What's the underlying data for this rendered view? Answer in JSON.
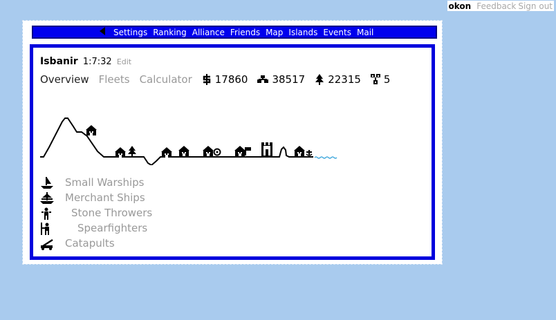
{
  "userbar": {
    "username": "okon",
    "links": [
      "Feedback",
      "Sign out"
    ]
  },
  "nav": {
    "back_icon": "back-arrow-icon",
    "items": [
      "Settings",
      "Ranking",
      "Alliance",
      "Friends",
      "Map",
      "Islands",
      "Events",
      "Mail"
    ]
  },
  "town": {
    "name": "Isbanir",
    "time": "1:7:32",
    "edit_label": "Edit"
  },
  "tabs": [
    {
      "label": "Overview",
      "active": true
    },
    {
      "label": "Fleets",
      "active": false
    },
    {
      "label": "Calculator",
      "active": false
    }
  ],
  "resources": [
    {
      "icon": "gold-icon",
      "value": "17860"
    },
    {
      "icon": "stone-icon",
      "value": "38517"
    },
    {
      "icon": "wood-icon",
      "value": "22315"
    },
    {
      "icon": "population-icon",
      "value": "5"
    }
  ],
  "units": [
    {
      "icon": "small-warship-icon",
      "label": "Small Warships"
    },
    {
      "icon": "merchant-ship-icon",
      "label": "Merchant Ships"
    },
    {
      "icon": "stone-thrower-icon",
      "label": "Stone Throwers"
    },
    {
      "icon": "spearfighter-icon",
      "label": "Spearfighters"
    },
    {
      "icon": "catapult-icon",
      "label": "Catapults"
    }
  ],
  "colors": {
    "background": "#a9cbee",
    "nav_blue": "#0000ee",
    "panel_border": "#0000dd",
    "muted_text": "#999999",
    "water": "#44aadd"
  }
}
